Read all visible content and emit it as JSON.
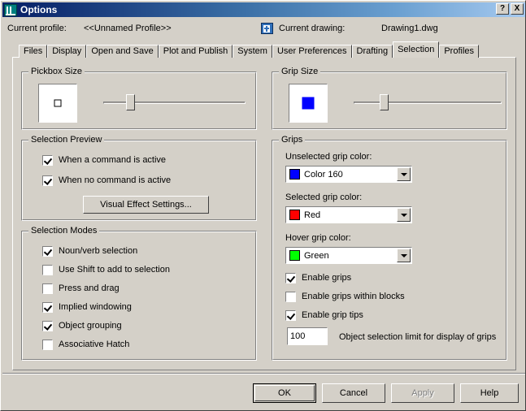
{
  "window": {
    "title": "Options",
    "icon": "autocad-app-icon",
    "help_button": "?",
    "close_button": "X"
  },
  "header": {
    "profile_label": "Current profile:",
    "profile_value": "<<Unnamed Profile>>",
    "drawing_icon": "drawing-document-icon",
    "drawing_label": "Current drawing:",
    "drawing_value": "Drawing1.dwg"
  },
  "tabs": [
    {
      "label": "Files",
      "active": false
    },
    {
      "label": "Display",
      "active": false
    },
    {
      "label": "Open and Save",
      "active": false
    },
    {
      "label": "Plot and Publish",
      "active": false
    },
    {
      "label": "System",
      "active": false
    },
    {
      "label": "User Preferences",
      "active": false
    },
    {
      "label": "Drafting",
      "active": false
    },
    {
      "label": "Selection",
      "active": true
    },
    {
      "label": "Profiles",
      "active": false
    }
  ],
  "pickbox_size": {
    "title": "Pickbox Size",
    "preview_marker": "pickbox-square-outline",
    "slider_value": 3,
    "slider_min": 0,
    "slider_max": 20
  },
  "grip_size": {
    "title": "Grip Size",
    "preview_marker": "grip-square-filled",
    "preview_color": "#0000ff",
    "slider_value": 4,
    "slider_min": 0,
    "slider_max": 20
  },
  "selection_preview": {
    "title": "Selection Preview",
    "checkboxes": [
      {
        "label": "When a command is active",
        "checked": true
      },
      {
        "label": "When no command is active",
        "checked": true
      }
    ],
    "visual_effect_button": "Visual Effect Settings..."
  },
  "selection_modes": {
    "title": "Selection Modes",
    "checkboxes": [
      {
        "label": "Noun/verb selection",
        "checked": true
      },
      {
        "label": "Use Shift to add to selection",
        "checked": false
      },
      {
        "label": "Press and drag",
        "checked": false
      },
      {
        "label": "Implied windowing",
        "checked": true
      },
      {
        "label": "Object grouping",
        "checked": true
      },
      {
        "label": "Associative Hatch",
        "checked": false
      }
    ]
  },
  "grips": {
    "title": "Grips",
    "dropdowns": [
      {
        "label": "Unselected grip color:",
        "value": "Color 160",
        "swatch": "#0000ff"
      },
      {
        "label": "Selected grip color:",
        "value": "Red",
        "swatch": "#ff0000"
      },
      {
        "label": "Hover grip color:",
        "value": "Green",
        "swatch": "#00ff00"
      }
    ],
    "checkboxes": [
      {
        "label": "Enable grips",
        "checked": true
      },
      {
        "label": "Enable grips within blocks",
        "checked": false
      },
      {
        "label": "Enable grip tips",
        "checked": true
      }
    ],
    "limit_value": "100",
    "limit_label": "Object selection limit for display of grips"
  },
  "footer": {
    "ok": "OK",
    "cancel": "Cancel",
    "apply": "Apply",
    "help": "Help",
    "apply_disabled": true
  },
  "colors": {
    "dialog_face": "#d4d0c8",
    "title_dark": "#0a246a",
    "title_light": "#a6caf0",
    "field_white": "#ffffff"
  }
}
